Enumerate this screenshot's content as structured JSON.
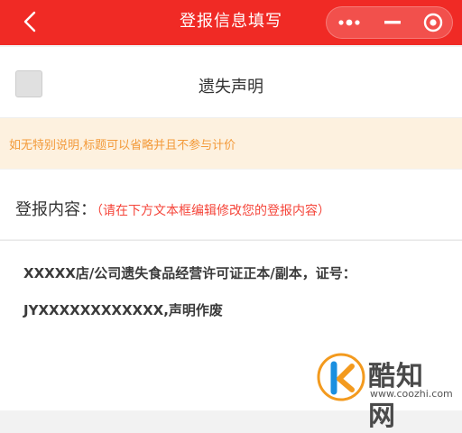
{
  "header": {
    "title": "登报信息填写",
    "background": "#f02a25"
  },
  "notice_option": {
    "label": "遗失声明",
    "checked": false
  },
  "tip": {
    "text": "如无特别说明,标题可以省略并且不参与计价"
  },
  "content": {
    "label": "登报内容：",
    "hint": "（请在下方文本框编辑修改您的登报内容）"
  },
  "editor": {
    "line1": "XXXXX店/公司遗失食品经营许可证正本/副本，证号：",
    "line2": "JYXXXXXXXXXXXX,声明作废"
  },
  "watermark": {
    "name": "酷知网",
    "url": "www.coozhi.com"
  }
}
